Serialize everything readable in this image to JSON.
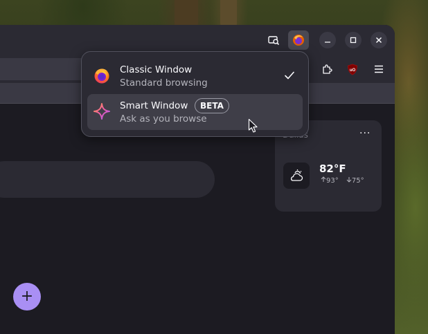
{
  "popup": {
    "items": [
      {
        "title": "Classic Window",
        "subtitle": "Standard browsing",
        "selected": true,
        "icon": "firefox-logo-icon"
      },
      {
        "title": "Smart Window",
        "subtitle": "Ask as you browse",
        "badge": "BETA",
        "selected": false,
        "icon": "sparkle-icon"
      }
    ]
  },
  "weather": {
    "city": "Dallas",
    "temperature": "82°F",
    "high": "93°",
    "low": "75°",
    "icon": "partly-cloudy-icon",
    "menu_label": "···"
  },
  "add_button": {
    "label": "+"
  },
  "toolbar_icons": [
    "screenshot-search-icon",
    "firefox-account-icon",
    "extensions-icon",
    "ublock-origin-icon",
    "hamburger-menu-icon"
  ],
  "window_controls": [
    "minimize-icon",
    "maximize-icon",
    "close-icon"
  ],
  "colors": {
    "accent_purple": "#a98ff4",
    "panel_bg": "#2b2a33",
    "content_bg": "#1c1b22",
    "popup_hover": "#3f3e48"
  }
}
